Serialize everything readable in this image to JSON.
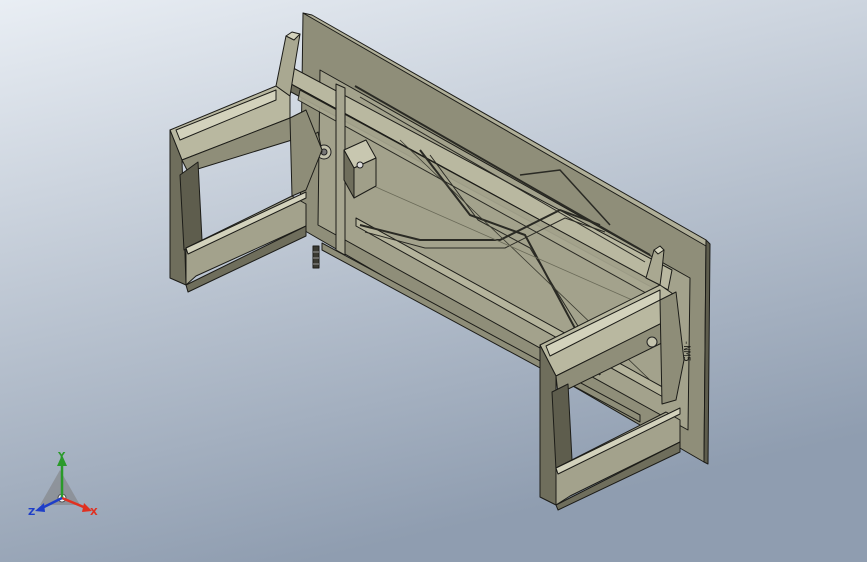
{
  "viewport": {
    "background_top": "#e9eef4",
    "background_bottom": "#8f9db0"
  },
  "model": {
    "body_color": "#9e9d86",
    "light_face_color": "#c3c2ab",
    "dark_face_color": "#6f6e5c",
    "edge_color": "#1c1c18",
    "marking_text": "-NM5"
  },
  "triad": {
    "x_label": "X",
    "y_label": "Y",
    "z_label": "Z",
    "x_color": "#e03020",
    "y_color": "#2a9a2a",
    "z_color": "#1e3ec8"
  }
}
